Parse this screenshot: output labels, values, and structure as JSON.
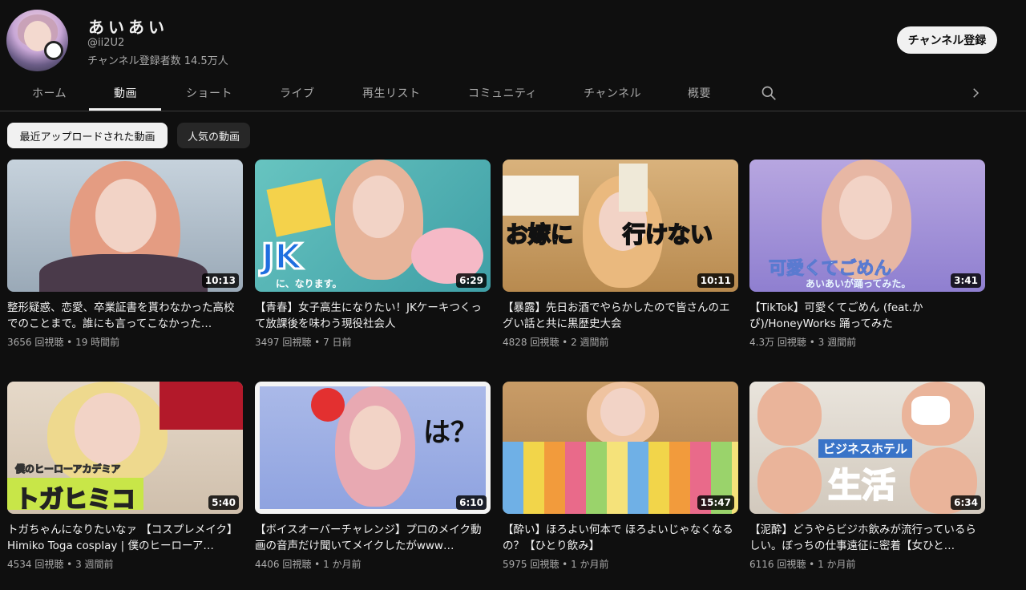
{
  "channel": {
    "name": "あいあい",
    "handle": "@ii2U2",
    "subscribers": "チャンネル登録者数 14.5万人",
    "subscribe_label": "チャンネル登録"
  },
  "tabs": [
    "ホーム",
    "動画",
    "ショート",
    "ライブ",
    "再生リスト",
    "コミュニティ",
    "チャンネル",
    "概要"
  ],
  "active_tab": "動画",
  "chips": [
    "最近アップロードされた動画",
    "人気の動画"
  ],
  "icons": {
    "search": "search-icon",
    "next": "chevron-right-icon"
  },
  "colors": {
    "background": "#0f0f0f",
    "text": "#f1f1f1",
    "muted": "#aaaaaa",
    "chip_selected": "#f1f1f1"
  },
  "videos": [
    {
      "title": "整形疑惑、恋愛、卒業証書を貰わなかった高校でのことまで。誰にも言ってこなかった…",
      "views": "3656 回視聴",
      "age": "19 時間前",
      "duration": "10:13",
      "thumb_text": []
    },
    {
      "title": "【青春】女子高生になりたい！JKケーキつくって放課後を味わう現役社会人",
      "views": "3497 回視聴",
      "age": "7 日前",
      "duration": "6:29",
      "thumb_text": [
        "JK",
        "に、なります。"
      ]
    },
    {
      "title": "【暴露】先日お酒でやらかしたので皆さんのエグい話と共に黒歴史大会",
      "views": "4828 回視聴",
      "age": "2 週間前",
      "duration": "10:11",
      "thumb_text": [
        "お嫁に",
        "行けない"
      ]
    },
    {
      "title": "【TikTok】可愛くてごめん (feat.かぴ)/HoneyWorks 踊ってみた",
      "views": "4.3万 回視聴",
      "age": "3 週間前",
      "duration": "3:41",
      "thumb_text": [
        "可愛くてごめん",
        "あいあいが踊ってみた。"
      ]
    },
    {
      "title": "トガちゃんになりたいなァ 【コスプレメイク】Himiko Toga cosplay | 僕のヒーローア…",
      "views": "4534 回視聴",
      "age": "3 週間前",
      "duration": "5:40",
      "thumb_text": [
        "僕のヒーローアカデミア",
        "トガヒミコ"
      ]
    },
    {
      "title": "【ボイスオーバーチャレンジ】プロのメイク動画の音声だけ聞いてメイクしたがwww…",
      "views": "4406 回視聴",
      "age": "1 か月前",
      "duration": "6:10",
      "thumb_text": [
        "は？"
      ]
    },
    {
      "title": "【酔い】ほろよい何本で ほろよいじゃなくなるの？【ひとり飲み】",
      "views": "5975 回視聴",
      "age": "1 か月前",
      "duration": "15:47",
      "thumb_text": []
    },
    {
      "title": "【泥酔】どうやらビジホ飲みが流行っているらしい。ぼっちの仕事遠征に密着【女ひと…",
      "views": "6116 回視聴",
      "age": "1 か月前",
      "duration": "6:34",
      "thumb_text": [
        "ビジネスホテル",
        "生活"
      ]
    }
  ]
}
